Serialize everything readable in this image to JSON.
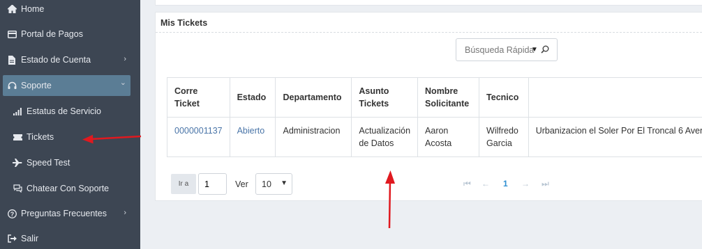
{
  "sidebar": {
    "items": [
      {
        "label": "Home",
        "icon": "home-icon"
      },
      {
        "label": "Portal de Pagos",
        "icon": "card-icon"
      },
      {
        "label": "Estado de Cuenta",
        "icon": "document-icon",
        "chevron": "›"
      },
      {
        "label": "Soporte",
        "icon": "headset-icon",
        "chevron": "⌄"
      },
      {
        "label": "Estatus de Servicio",
        "icon": "signal-icon"
      },
      {
        "label": "Tickets",
        "icon": "ticket-icon"
      },
      {
        "label": "Speed Test",
        "icon": "plane-icon"
      },
      {
        "label": "Chatear Con Soporte",
        "icon": "chat-icon"
      },
      {
        "label": "Preguntas Frecuentes",
        "icon": "question-icon",
        "chevron": "›"
      },
      {
        "label": "Salir",
        "icon": "logout-icon"
      }
    ]
  },
  "panel": {
    "title": "Mis Tickets",
    "search_placeholder": "Búsqueda Rápida"
  },
  "table": {
    "headers": [
      "Corre Ticket",
      "Estado",
      "Departamento",
      "Asunto Tickets",
      "Nombre Solicitante",
      "Tecnico",
      ""
    ],
    "rows": [
      [
        "0000001137",
        "Abierto",
        "Administracion",
        "Actualización de Datos",
        "Aaron Acosta",
        "Wilfredo Garcia",
        "Urbanizacion el Soler Por El Troncal 6 Aven"
      ]
    ]
  },
  "pagination": {
    "goto_label": "Ir a",
    "page_value": "1",
    "ver_label": "Ver",
    "page_size": "10",
    "current_page": "1"
  },
  "colors": {
    "sidebar_bg": "#3d4653",
    "active_bg": "#5b7d95",
    "link": "#4a75a8",
    "annotation_arrow": "#e0191f"
  }
}
